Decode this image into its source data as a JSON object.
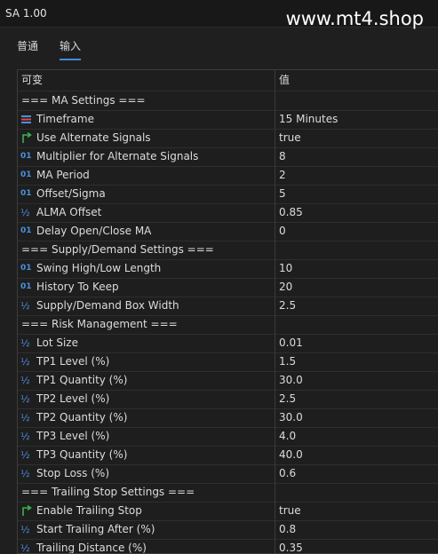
{
  "window": {
    "title": "SA 1.00",
    "watermark": "www.mt4.shop"
  },
  "tabs": [
    {
      "label": "普通",
      "active": false
    },
    {
      "label": "输入",
      "active": true
    }
  ],
  "columns": {
    "name": "可变",
    "value": "值"
  },
  "rows": [
    {
      "kind": "section",
      "label": "=== MA Settings ===",
      "value": ""
    },
    {
      "kind": "param",
      "icon": "timeframe-icon",
      "label": "Timeframe",
      "value": "15 Minutes"
    },
    {
      "kind": "param",
      "icon": "bool-icon",
      "label": "Use Alternate Signals",
      "value": "true"
    },
    {
      "kind": "param",
      "icon": "int-icon",
      "label": "Multiplier for Alternate Signals",
      "value": "8"
    },
    {
      "kind": "param",
      "icon": "int-icon",
      "label": "MA Period",
      "value": "2"
    },
    {
      "kind": "param",
      "icon": "int-icon",
      "label": "Offset/Sigma",
      "value": "5"
    },
    {
      "kind": "param",
      "icon": "double-icon",
      "label": "ALMA Offset",
      "value": "0.85"
    },
    {
      "kind": "param",
      "icon": "int-icon",
      "label": "Delay Open/Close MA",
      "value": "0"
    },
    {
      "kind": "section",
      "label": "=== Supply/Demand Settings ===",
      "value": ""
    },
    {
      "kind": "param",
      "icon": "int-icon",
      "label": "Swing High/Low Length",
      "value": "10"
    },
    {
      "kind": "param",
      "icon": "int-icon",
      "label": "History To Keep",
      "value": "20"
    },
    {
      "kind": "param",
      "icon": "double-icon",
      "label": "Supply/Demand Box Width",
      "value": "2.5"
    },
    {
      "kind": "section",
      "label": "=== Risk Management ===",
      "value": ""
    },
    {
      "kind": "param",
      "icon": "double-icon",
      "label": "Lot Size",
      "value": "0.01"
    },
    {
      "kind": "param",
      "icon": "double-icon",
      "label": "TP1 Level (%)",
      "value": "1.5"
    },
    {
      "kind": "param",
      "icon": "double-icon",
      "label": "TP1 Quantity (%)",
      "value": "30.0"
    },
    {
      "kind": "param",
      "icon": "double-icon",
      "label": "TP2 Level (%)",
      "value": "2.5"
    },
    {
      "kind": "param",
      "icon": "double-icon",
      "label": "TP2 Quantity (%)",
      "value": "30.0"
    },
    {
      "kind": "param",
      "icon": "double-icon",
      "label": "TP3 Level (%)",
      "value": "4.0"
    },
    {
      "kind": "param",
      "icon": "double-icon",
      "label": "TP3 Quantity (%)",
      "value": "40.0"
    },
    {
      "kind": "param",
      "icon": "double-icon",
      "label": "Stop Loss (%)",
      "value": "0.6"
    },
    {
      "kind": "section",
      "label": "=== Trailing Stop Settings ===",
      "value": ""
    },
    {
      "kind": "param",
      "icon": "bool-icon",
      "label": "Enable Trailing Stop",
      "value": "true"
    },
    {
      "kind": "param",
      "icon": "double-icon",
      "label": "Start Trailing After (%)",
      "value": "0.8"
    },
    {
      "kind": "param",
      "icon": "double-icon",
      "label": "Trailing Distance (%)",
      "value": "0.35"
    }
  ],
  "glyphs": {
    "int": "01",
    "double": "½"
  },
  "colors": {
    "accent": "#3c8cdc",
    "int_icon": "#4a8fe0",
    "bool_icon": "#3cb050"
  }
}
